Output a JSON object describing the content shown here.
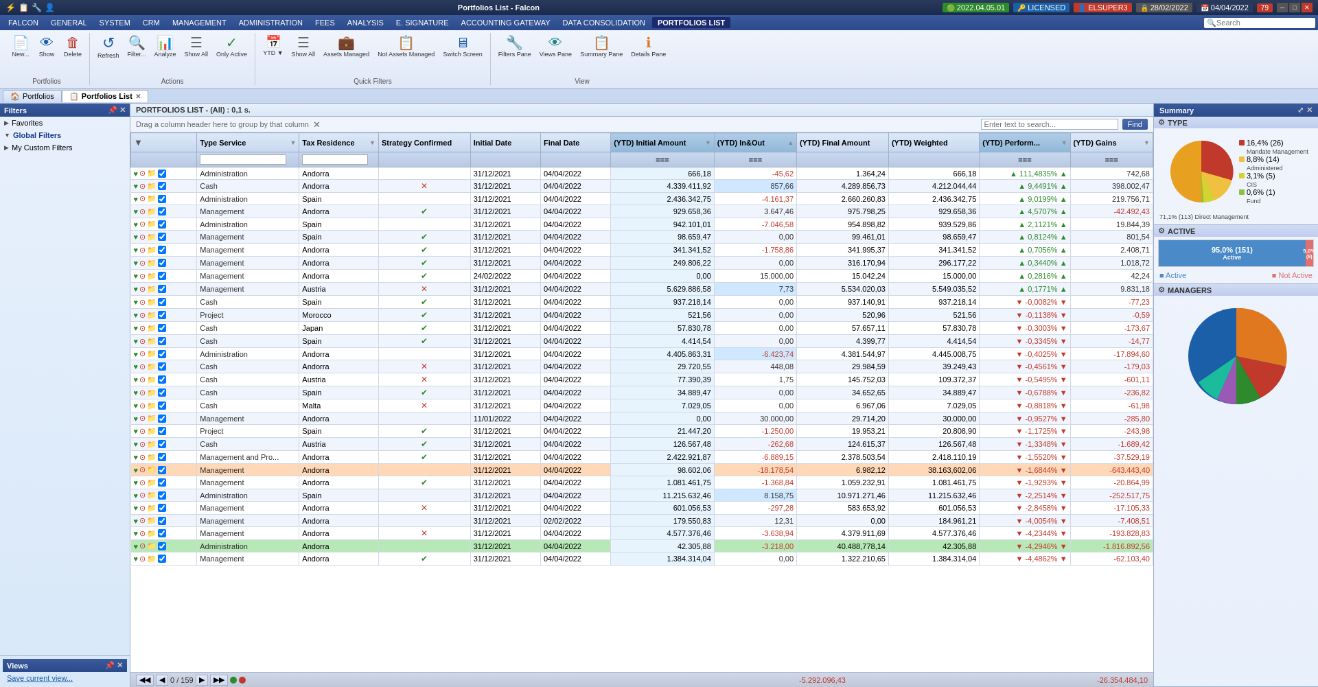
{
  "titlebar": {
    "title": "Portfolios List - Falcon",
    "version": "2022.04.05.01",
    "license": "LICENSED",
    "user": "ELSUPER3",
    "date1": "28/02/2022",
    "date2": "04/04/2022",
    "counter": "79"
  },
  "menubar": {
    "items": [
      "FALCON",
      "GENERAL",
      "SYSTEM",
      "CRM",
      "MANAGEMENT",
      "ADMINISTRATION",
      "FEES",
      "ANALYSIS",
      "E. SIGNATURE",
      "ACCOUNTING GATEWAY",
      "DATA CONSOLIDATION",
      "PORTFOLIOS LIST"
    ],
    "active": "PORTFOLIOS LIST",
    "search_placeholder": "Search"
  },
  "toolbar": {
    "groups": [
      {
        "label": "Portfolios",
        "buttons": [
          {
            "icon": "📄",
            "label": "New...",
            "name": "new-button"
          },
          {
            "icon": "👁",
            "label": "Show",
            "name": "show-button"
          },
          {
            "icon": "🗑",
            "label": "Delete",
            "name": "delete-button"
          }
        ]
      },
      {
        "label": "Actions",
        "buttons": [
          {
            "icon": "↺",
            "label": "Refresh",
            "name": "refresh-button"
          },
          {
            "icon": "🔍",
            "label": "Filter...",
            "name": "filter-button"
          },
          {
            "icon": "📊",
            "label": "Analyze",
            "name": "analyze-button"
          },
          {
            "icon": "☰",
            "label": "Show All",
            "name": "showall-button"
          },
          {
            "icon": "✓",
            "label": "Only Active",
            "name": "onlyactive-button"
          }
        ]
      },
      {
        "label": "Quick Filters",
        "buttons": [
          {
            "icon": "📅",
            "label": "YTD",
            "name": "ytd-button"
          },
          {
            "icon": "☰",
            "label": "Show All",
            "name": "qf-showall-button"
          },
          {
            "icon": "💼",
            "label": "Assets Managed",
            "name": "assets-managed-button"
          },
          {
            "icon": "📋",
            "label": "Not Assets Managed",
            "name": "not-assets-managed-button"
          },
          {
            "icon": "🖥",
            "label": "Switch Screen",
            "name": "switch-screen-button"
          }
        ]
      },
      {
        "label": "View",
        "buttons": [
          {
            "icon": "🔧",
            "label": "Filters Pane",
            "name": "filters-pane-button"
          },
          {
            "icon": "👁",
            "label": "Views Pane",
            "name": "views-pane-button"
          },
          {
            "icon": "📋",
            "label": "Summary Pane",
            "name": "summary-pane-button"
          },
          {
            "icon": "ℹ",
            "label": "Details Pane",
            "name": "details-pane-button"
          }
        ]
      }
    ]
  },
  "tabs": {
    "items": [
      {
        "label": "Portfolios",
        "name": "portfolios-tab",
        "active": false,
        "closeable": false
      },
      {
        "label": "Portfolios List",
        "name": "portfolios-list-tab",
        "active": true,
        "closeable": true
      }
    ]
  },
  "filters": {
    "header": "Filters",
    "sections": [
      {
        "label": "Favorites",
        "name": "favorites-section",
        "expanded": false
      },
      {
        "label": "Global Filters",
        "name": "global-filters-section",
        "expanded": true,
        "active": true
      },
      {
        "label": "My Custom Filters",
        "name": "custom-filters-section",
        "expanded": false
      }
    ]
  },
  "views": {
    "header": "Views",
    "save_link": "Save current view..."
  },
  "content": {
    "header": "PORTFOLIOS LIST - (All) : 0,1 s.",
    "drag_hint": "Drag a column header here to group by that column",
    "search_placeholder": "Enter text to search...",
    "find_btn": "Find"
  },
  "table": {
    "columns": [
      {
        "label": "",
        "name": "col-icons"
      },
      {
        "label": "Type Service",
        "name": "col-type-service"
      },
      {
        "label": "Tax Residence",
        "name": "col-tax-residence"
      },
      {
        "label": "Strategy Confirmed",
        "name": "col-strategy"
      },
      {
        "label": "Initial Date",
        "name": "col-initial-date"
      },
      {
        "label": "Final Date",
        "name": "col-final-date"
      },
      {
        "label": "(YTD) Initial Amount",
        "name": "col-ytd-initial",
        "highlight": true
      },
      {
        "label": "(YTD) In&Out",
        "name": "col-ytd-inout",
        "highlight": true
      },
      {
        "label": "(YTD) Final Amount",
        "name": "col-ytd-final"
      },
      {
        "label": "(YTD) Weighted",
        "name": "col-ytd-weighted"
      },
      {
        "label": "(YTD) Perform...",
        "name": "col-ytd-perform",
        "highlight": true
      },
      {
        "label": "(YTD) Gains",
        "name": "col-ytd-gains"
      }
    ],
    "rows": [
      {
        "type": "Administration",
        "tax": "Andorra",
        "strategy": "",
        "initial": "31/12/2021",
        "final": "04/04/2022",
        "ytd_initial": "666,18",
        "ytd_inout": "-45,62",
        "ytd_final": "1.364,24",
        "ytd_weighted": "666,18",
        "ytd_perf": "111,4835%",
        "ytd_gains": "742,68",
        "perf_up": true
      },
      {
        "type": "Cash",
        "tax": "Andorra",
        "strategy": "❌",
        "initial": "31/12/2021",
        "final": "04/04/2022",
        "ytd_initial": "4.339.411,92",
        "ytd_inout": "857,66",
        "ytd_final": "4.289.856,73",
        "ytd_weighted": "4.212.044,44",
        "ytd_perf": "9,4491%",
        "ytd_gains": "398.002,47",
        "perf_up": true,
        "inout_highlight": true
      },
      {
        "type": "Administration",
        "tax": "Spain",
        "strategy": "",
        "initial": "31/12/2021",
        "final": "04/04/2022",
        "ytd_initial": "2.436.342,75",
        "ytd_inout": "-4.161,37",
        "ytd_final": "2.660.260,83",
        "ytd_weighted": "2.436.342,75",
        "ytd_perf": "9,0199%",
        "ytd_gains": "219.756,71",
        "perf_up": true
      },
      {
        "type": "Management",
        "tax": "Andorra",
        "strategy": "✅",
        "initial": "31/12/2021",
        "final": "04/04/2022",
        "ytd_initial": "929.658,36",
        "ytd_inout": "3.647,46",
        "ytd_final": "975.798,25",
        "ytd_weighted": "929.658,36",
        "ytd_perf": "4,5707%",
        "ytd_gains": "-42.492,43",
        "perf_up": true
      },
      {
        "type": "Administration",
        "tax": "Spain",
        "strategy": "",
        "initial": "31/12/2021",
        "final": "04/04/2022",
        "ytd_initial": "942.101,01",
        "ytd_inout": "-7.046,58",
        "ytd_final": "954.898,82",
        "ytd_weighted": "939.529,86",
        "ytd_perf": "2,1121%",
        "ytd_gains": "19.844,39",
        "perf_up": true
      },
      {
        "type": "Management",
        "tax": "Spain",
        "strategy": "✅",
        "initial": "31/12/2021",
        "final": "04/04/2022",
        "ytd_initial": "98.659,47",
        "ytd_inout": "0,00",
        "ytd_final": "99.461,01",
        "ytd_weighted": "98.659,47",
        "ytd_perf": "0,8124%",
        "ytd_gains": "801,54",
        "perf_up": true
      },
      {
        "type": "Management",
        "tax": "Andorra",
        "strategy": "✅",
        "initial": "31/12/2021",
        "final": "04/04/2022",
        "ytd_initial": "341.341,52",
        "ytd_inout": "-1.758,86",
        "ytd_final": "341.995,37",
        "ytd_weighted": "341.341,52",
        "ytd_perf": "0,7056%",
        "ytd_gains": "2.408,71",
        "perf_up": true
      },
      {
        "type": "Management",
        "tax": "Andorra",
        "strategy": "✅",
        "initial": "31/12/2021",
        "final": "04/04/2022",
        "ytd_initial": "249.806,22",
        "ytd_inout": "0,00",
        "ytd_final": "316.170,94",
        "ytd_weighted": "296.177,22",
        "ytd_perf": "0,3440%",
        "ytd_gains": "1.018,72",
        "perf_up": true
      },
      {
        "type": "Management",
        "tax": "Andorra",
        "strategy": "✅",
        "initial": "24/02/2022",
        "final": "04/04/2022",
        "ytd_initial": "0,00",
        "ytd_inout": "15.000,00",
        "ytd_final": "15.042,24",
        "ytd_weighted": "15.000,00",
        "ytd_perf": "0,2816%",
        "ytd_gains": "42,24",
        "perf_up": true
      },
      {
        "type": "Management",
        "tax": "Austria",
        "strategy": "❌",
        "initial": "31/12/2021",
        "final": "04/04/2022",
        "ytd_initial": "5.629.886,58",
        "ytd_inout": "7,73",
        "ytd_final": "5.534.020,03",
        "ytd_weighted": "5.549.035,52",
        "ytd_perf": "0,1771%",
        "ytd_gains": "9.831,18",
        "perf_up": true,
        "inout_highlight": true
      },
      {
        "type": "Cash",
        "tax": "Spain",
        "strategy": "✅",
        "initial": "31/12/2021",
        "final": "04/04/2022",
        "ytd_initial": "937.218,14",
        "ytd_inout": "0,00",
        "ytd_final": "937.140,91",
        "ytd_weighted": "937.218,14",
        "ytd_perf": "-0,0082%",
        "ytd_gains": "-77,23",
        "perf_up": false
      },
      {
        "type": "Project",
        "tax": "Morocco",
        "strategy": "✅",
        "initial": "31/12/2021",
        "final": "04/04/2022",
        "ytd_initial": "521,56",
        "ytd_inout": "0,00",
        "ytd_final": "520,96",
        "ytd_weighted": "521,56",
        "ytd_perf": "-0,1138%",
        "ytd_gains": "-0,59",
        "perf_up": false
      },
      {
        "type": "Cash",
        "tax": "Japan",
        "strategy": "✅",
        "initial": "31/12/2021",
        "final": "04/04/2022",
        "ytd_initial": "57.830,78",
        "ytd_inout": "0,00",
        "ytd_final": "57.657,11",
        "ytd_weighted": "57.830,78",
        "ytd_perf": "-0,3003%",
        "ytd_gains": "-173,67",
        "perf_up": false
      },
      {
        "type": "Cash",
        "tax": "Spain",
        "strategy": "✅",
        "initial": "31/12/2021",
        "final": "04/04/2022",
        "ytd_initial": "4.414,54",
        "ytd_inout": "0,00",
        "ytd_final": "4.399,77",
        "ytd_weighted": "4.414,54",
        "ytd_perf": "-0,3345%",
        "ytd_gains": "-14,77",
        "perf_up": false
      },
      {
        "type": "Administration",
        "tax": "Andorra",
        "strategy": "",
        "initial": "31/12/2021",
        "final": "04/04/2022",
        "ytd_initial": "4.405.863,31",
        "ytd_inout": "-6.423,74",
        "ytd_final": "4.381.544,97",
        "ytd_weighted": "4.445.008,75",
        "ytd_perf": "-0,4025%",
        "ytd_gains": "-17.894,60",
        "perf_up": false,
        "inout_highlight": true
      },
      {
        "type": "Cash",
        "tax": "Andorra",
        "strategy": "❌",
        "initial": "31/12/2021",
        "final": "04/04/2022",
        "ytd_initial": "29.720,55",
        "ytd_inout": "448,08",
        "ytd_final": "29.984,59",
        "ytd_weighted": "39.249,43",
        "ytd_perf": "-0,4561%",
        "ytd_gains": "-179,03",
        "perf_up": false
      },
      {
        "type": "Cash",
        "tax": "Austria",
        "strategy": "❌",
        "initial": "31/12/2021",
        "final": "04/04/2022",
        "ytd_initial": "77.390,39",
        "ytd_inout": "1,75",
        "ytd_final": "145.752,03",
        "ytd_weighted": "109.372,37",
        "ytd_perf": "-0,5495%",
        "ytd_gains": "-601,11",
        "perf_up": false
      },
      {
        "type": "Cash",
        "tax": "Spain",
        "strategy": "✅",
        "initial": "31/12/2021",
        "final": "04/04/2022",
        "ytd_initial": "34.889,47",
        "ytd_inout": "0,00",
        "ytd_final": "34.652,65",
        "ytd_weighted": "34.889,47",
        "ytd_perf": "-0,6788%",
        "ytd_gains": "-236,82",
        "perf_up": false
      },
      {
        "type": "Cash",
        "tax": "Malta",
        "strategy": "❌",
        "initial": "31/12/2021",
        "final": "04/04/2022",
        "ytd_initial": "7.029,05",
        "ytd_inout": "0,00",
        "ytd_final": "6.967,06",
        "ytd_weighted": "7.029,05",
        "ytd_perf": "-0,8818%",
        "ytd_gains": "-61,98",
        "perf_up": false
      },
      {
        "type": "Management",
        "tax": "Andorra",
        "strategy": "",
        "initial": "11/01/2022",
        "final": "04/04/2022",
        "ytd_initial": "0,00",
        "ytd_inout": "30.000,00",
        "ytd_final": "29.714,20",
        "ytd_weighted": "30.000,00",
        "ytd_perf": "-0,9527%",
        "ytd_gains": "-285,80",
        "perf_up": false
      },
      {
        "type": "Project",
        "tax": "Spain",
        "strategy": "✅",
        "initial": "31/12/2021",
        "final": "04/04/2022",
        "ytd_initial": "21.447,20",
        "ytd_inout": "-1.250,00",
        "ytd_final": "19.953,21",
        "ytd_weighted": "20.808,90",
        "ytd_perf": "-1,1725%",
        "ytd_gains": "-243,98",
        "perf_up": false
      },
      {
        "type": "Cash",
        "tax": "Austria",
        "strategy": "✅",
        "initial": "31/12/2021",
        "final": "04/04/2022",
        "ytd_initial": "126.567,48",
        "ytd_inout": "-262,68",
        "ytd_final": "124.615,37",
        "ytd_weighted": "126.567,48",
        "ytd_perf": "-1,3348%",
        "ytd_gains": "-1.689,42",
        "perf_up": false
      },
      {
        "type": "Management and Pro...",
        "tax": "Andorra",
        "strategy": "✅",
        "initial": "31/12/2021",
        "final": "04/04/2022",
        "ytd_initial": "2.422.921,87",
        "ytd_inout": "-6.889,15",
        "ytd_final": "2.378.503,54",
        "ytd_weighted": "2.418.110,19",
        "ytd_perf": "-1,5520%",
        "ytd_gains": "-37.529,19",
        "perf_up": false
      },
      {
        "type": "Management",
        "tax": "Andorra",
        "strategy": "",
        "initial": "31/12/2021",
        "final": "04/04/2022",
        "ytd_initial": "98.602,06",
        "ytd_inout": "-18.178,54",
        "ytd_final": "6.982,12",
        "ytd_weighted": "38.163,602,06",
        "ytd_perf": "-1,6844%",
        "ytd_gains": "-643.443,40",
        "perf_up": false,
        "row_highlight": true
      },
      {
        "type": "Management",
        "tax": "Andorra",
        "strategy": "✅",
        "initial": "31/12/2021",
        "final": "04/04/2022",
        "ytd_initial": "1.081.461,75",
        "ytd_inout": "-1.368,84",
        "ytd_final": "1.059.232,91",
        "ytd_weighted": "1.081.461,75",
        "ytd_perf": "-1,9293%",
        "ytd_gains": "-20.864,99",
        "perf_up": false
      },
      {
        "type": "Administration",
        "tax": "Spain",
        "strategy": "",
        "initial": "31/12/2021",
        "final": "04/04/2022",
        "ytd_initial": "11.215.632,46",
        "ytd_inout": "8.158,75",
        "ytd_final": "10.971.271,46",
        "ytd_weighted": "11.215.632,46",
        "ytd_perf": "-2,2514%",
        "ytd_gains": "-252.517,75",
        "perf_up": false,
        "inout_highlight": true
      },
      {
        "type": "Management",
        "tax": "Andorra",
        "strategy": "❌",
        "initial": "31/12/2021",
        "final": "04/04/2022",
        "ytd_initial": "601.056,53",
        "ytd_inout": "-297,28",
        "ytd_final": "583.653,92",
        "ytd_weighted": "601.056,53",
        "ytd_perf": "-2,8458%",
        "ytd_gains": "-17.105,33",
        "perf_up": false
      },
      {
        "type": "Management",
        "tax": "Andorra",
        "strategy": "",
        "initial": "31/12/2021",
        "final": "02/02/2022",
        "ytd_initial": "179.550,83",
        "ytd_inout": "12,31",
        "ytd_final": "0,00",
        "ytd_weighted": "184.961,21",
        "ytd_perf": "-4,0054%",
        "ytd_gains": "-7.408,51",
        "perf_up": false
      },
      {
        "type": "Management",
        "tax": "Andorra",
        "strategy": "❌",
        "initial": "31/12/2021",
        "final": "04/04/2022",
        "ytd_initial": "4.577.376,46",
        "ytd_inout": "-3.638,94",
        "ytd_final": "4.379.911,69",
        "ytd_weighted": "4.577.376,46",
        "ytd_perf": "-4,2344%",
        "ytd_gains": "-193.828,83",
        "perf_up": false
      },
      {
        "type": "Administration",
        "tax": "Andorra",
        "strategy": "",
        "initial": "31/12/2021",
        "final": "04/04/2022",
        "ytd_initial": "42.305,88",
        "ytd_inout": "-3.218,00",
        "ytd_final": "40.488,778,14",
        "ytd_weighted": "42.305,88",
        "ytd_perf": "-4,2946%",
        "ytd_gains": "-1.816.892,56",
        "perf_up": false,
        "row_highlight2": true
      },
      {
        "type": "Management",
        "tax": "Andorra",
        "strategy": "✅",
        "initial": "31/12/2021",
        "final": "04/04/2022",
        "ytd_initial": "1.384.314,04",
        "ytd_inout": "0,00",
        "ytd_final": "1.322.210,65",
        "ytd_weighted": "1.384.314,04",
        "ytd_perf": "-4,4862%",
        "ytd_gains": "-62.103,40",
        "perf_up": false
      }
    ]
  },
  "status_bar": {
    "nav": "◀◀ ◀ 0 / 159 ▶ ▶▶",
    "count": "0 / 159",
    "total_inout": "-5.292.096,43",
    "total_gains": "-26.354.484,10"
  },
  "summary": {
    "header": "Summary",
    "type_section": {
      "title": "TYPE",
      "segments": [
        {
          "label": "Direct Management",
          "pct": "71,1%",
          "count": "113",
          "color": "#e8a020"
        },
        {
          "label": "Mandate Management",
          "pct": "16,4%",
          "count": "26",
          "color": "#c0392b"
        },
        {
          "label": "Administered",
          "pct": "8,8%",
          "count": "14",
          "color": "#f0c040"
        },
        {
          "label": "CIS",
          "pct": "3,1%",
          "count": "5",
          "color": "#e0e060"
        },
        {
          "label": "Fund",
          "pct": "0,6%",
          "count": "1",
          "color": "#a0c860"
        }
      ]
    },
    "active_section": {
      "title": "ACTIVE",
      "active_pct": "95,0%",
      "active_count": "151",
      "active_label": "Active",
      "inactive_pct": "5,0%",
      "inactive_count": "8",
      "inactive_label": "Not Active"
    },
    "managers_section": {
      "title": "MANAGERS",
      "segments": [
        {
          "color": "#1a5fa8",
          "pct": 35
        },
        {
          "color": "#e07820",
          "pct": 25
        },
        {
          "color": "#c0392b",
          "pct": 20
        },
        {
          "color": "#2d8a2d",
          "pct": 10
        },
        {
          "color": "#9b59b6",
          "pct": 5
        },
        {
          "color": "#1abc9c",
          "pct": 5
        }
      ]
    }
  }
}
